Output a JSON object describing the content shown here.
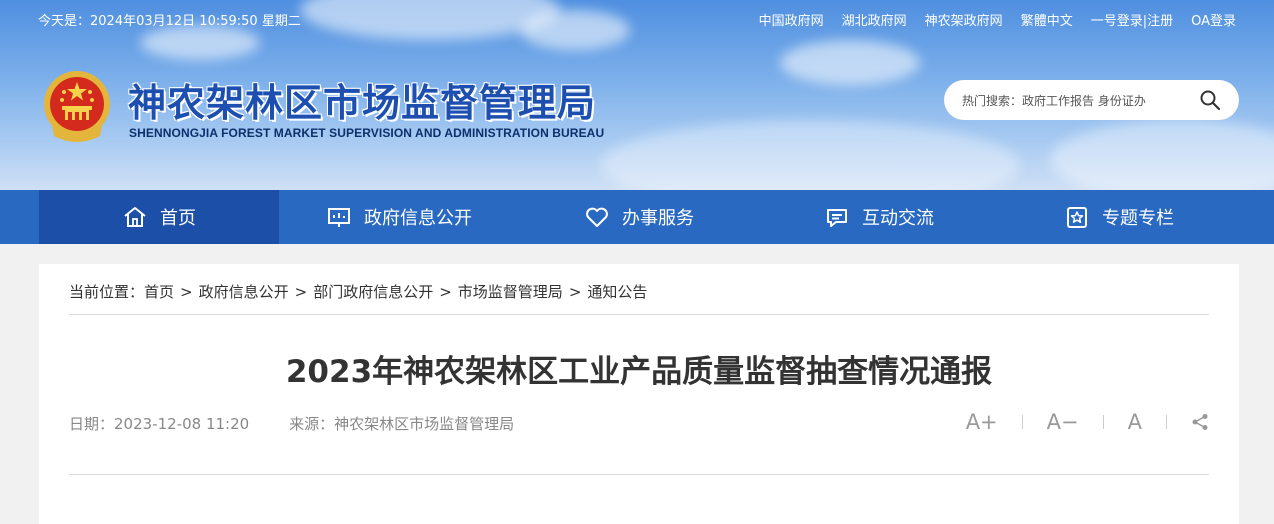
{
  "header": {
    "date": "今天是：2024年03月12日 10:59:50 星期二",
    "top_links": [
      "中国政府网",
      "湖北政府网",
      "神农架政府网",
      "繁體中文",
      "一号登录|注册",
      "OA登录"
    ],
    "site_title": "神农架林区市场监督管理局",
    "site_subtitle": "SHENNONGJIA FOREST MARKET SUPERVISION AND ADMINISTRATION BUREAU",
    "search_placeholder": "热门搜索：政府工作报告 身份证办"
  },
  "nav": {
    "items": [
      {
        "label": "首页",
        "icon": "home-icon"
      },
      {
        "label": "政府信息公开",
        "icon": "presentation-icon"
      },
      {
        "label": "办事服务",
        "icon": "heart-icon"
      },
      {
        "label": "互动交流",
        "icon": "chat-icon"
      },
      {
        "label": "专题专栏",
        "icon": "star-badge-icon"
      }
    ],
    "active_color": "#1b4fa8",
    "bar_color": "#2a69c2"
  },
  "breadcrumb": {
    "prefix": "当前位置：",
    "items": [
      "首页",
      "政府信息公开",
      "部门政府信息公开",
      "市场监督管理局",
      "通知公告"
    ],
    "separator": ">"
  },
  "article": {
    "title": "2023年神农架林区工业产品质量监督抽查情况通报",
    "date": "日期：2023-12-08 11:20",
    "source": "来源：神农架林区市场监督管理局",
    "tools": [
      "A+",
      "A−",
      "A"
    ]
  }
}
